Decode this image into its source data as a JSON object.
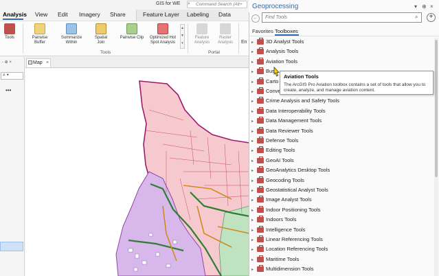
{
  "app": {
    "title": "GIS for WE",
    "command_search_placeholder": "Command Search (Alt+"
  },
  "ribbon": {
    "tabs": [
      {
        "label": "Analysis",
        "active": true
      },
      {
        "label": "View"
      },
      {
        "label": "Edit"
      },
      {
        "label": "Imagery"
      },
      {
        "label": "Share"
      },
      {
        "label": "Feature Layer"
      },
      {
        "label": "Labeling"
      },
      {
        "label": "Data"
      }
    ],
    "buttons": {
      "tools": "Tools",
      "pairwise_buffer": "Pairwise Buffer",
      "summarize_within": "Summarize Within",
      "spatial_join": "Spatial Join",
      "pairwise_clip": "Pairwise Clip",
      "optimized_hot_spot": "Optimized Hot Spot Analysis",
      "feature_analysis": "Feature Analysis",
      "raster_analysis": "Raster Analysis",
      "en": "En"
    },
    "groups": {
      "tools": "Tools",
      "portal": "Portal"
    }
  },
  "left_pane": {
    "pin": "- ⊕ ×",
    "more": "•••"
  },
  "map": {
    "tab_label": "Map"
  },
  "geoprocessing": {
    "title": "Geoprocessing",
    "search_placeholder": "Find Tools",
    "tabs": [
      "Favorites",
      "Toolboxes"
    ],
    "active_tab": "Toolboxes",
    "toolboxes": [
      "3D Analyst Tools",
      "Analysis Tools",
      "Aviation Tools",
      "Business Analyst Tools",
      "Cartography Tools",
      "Conversion Tools",
      "Crime Analysis and Safety Tools",
      "Data Interoperability Tools",
      "Data Management Tools",
      "Data Reviewer Tools",
      "Defense Tools",
      "Editing Tools",
      "GeoAI Tools",
      "GeoAnalytics Desktop Tools",
      "Geocoding Tools",
      "Geostatistical Analyst Tools",
      "Image Analyst Tools",
      "Indoor Positioning Tools",
      "Indoors Tools",
      "Intelligence Tools",
      "Linear Referencing Tools",
      "Location Referencing Tools",
      "Maritime Tools",
      "Multidimension Tools"
    ],
    "toolbox_visible_labels": [
      "3D Analyst Tools",
      "Analysis Tools",
      "Aviation Tools",
      "Bus",
      "Carto",
      "Conve",
      "Crime Analysis and Safety Tools",
      "Data Interoperability Tools",
      "Data Management Tools",
      "Data Reviewer Tools",
      "Defense Tools",
      "Editing Tools",
      "GeoAI Tools",
      "GeoAnalytics Desktop Tools",
      "Geocoding Tools",
      "Geostatistical Analyst Tools",
      "Image Analyst Tools",
      "Indoor Positioning Tools",
      "Indoors Tools",
      "Intelligence Tools",
      "Linear Referencing Tools",
      "Location Referencing Tools",
      "Maritime Tools",
      "Multidimension Tools"
    ],
    "tooltip": {
      "title": "Aviation Tools",
      "body": "The ArcGIS Pro Aviation toolbox contains a set of tools that allow you to create, analyze, and manage aviation content."
    }
  },
  "colors": {
    "accent": "#2b6cb0",
    "toolbox_icon": "#c0504d",
    "parcel_pink": "#f6c9cf",
    "parcel_purple": "#d8b8ea",
    "road_green": "#2e7d32",
    "boundary_magenta": "#9c1a6d"
  }
}
